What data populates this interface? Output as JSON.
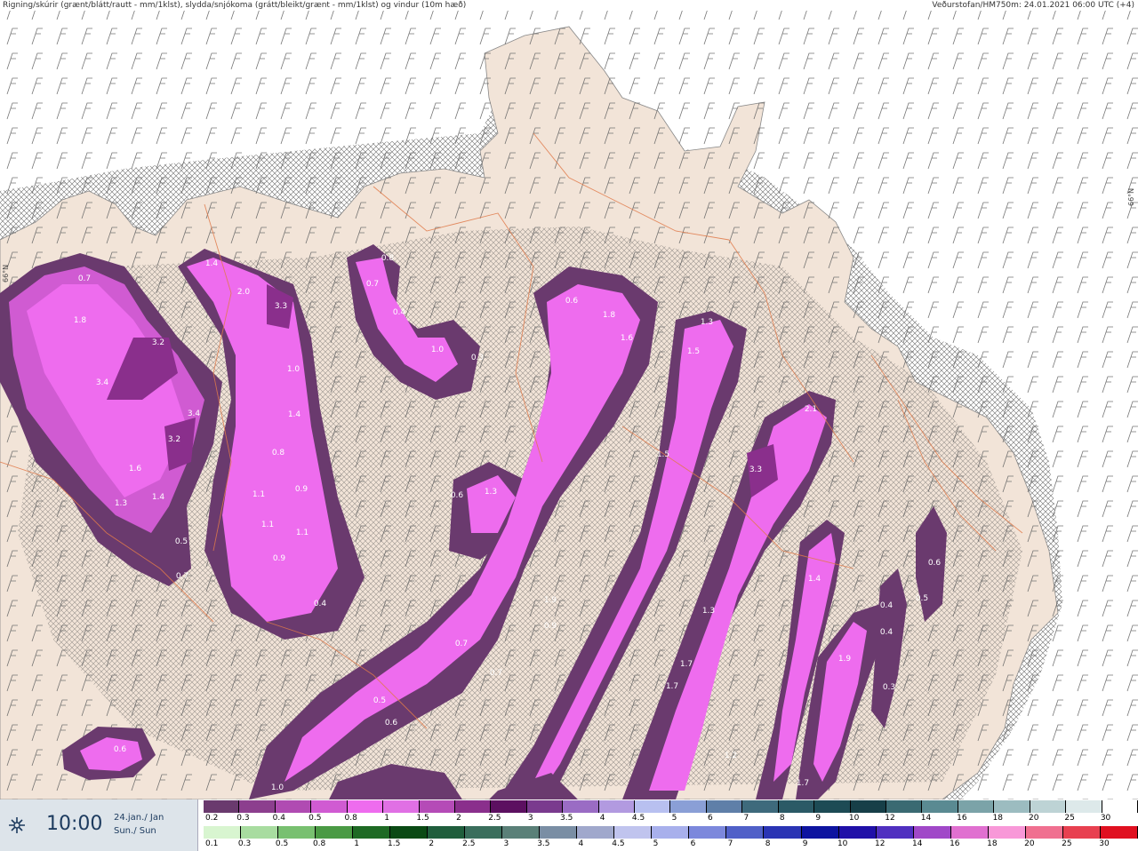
{
  "header": {
    "left": "Rigning/skúrir (grænt/blátt/rautt - mm/1klst), slydda/snjókoma (grátt/bleikt/grænt - mm/1klst) og vindur (10m hæð)",
    "right": "Veðurstofan/HM750m: 24.01.2021 06:00 UTC (+4)"
  },
  "latitude_labels": [
    "66°N",
    "66°N"
  ],
  "footer": {
    "time": "10:00",
    "date_line1": "24.jan./ Jan",
    "date_line2": "Sun./ Sun"
  },
  "legend_snow": {
    "labels": [
      "0.2",
      "0.3",
      "0.4",
      "0.5",
      "0.8",
      "1",
      "1.5",
      "2",
      "2.5",
      "3",
      "3.5",
      "4",
      "4.5",
      "5",
      "6",
      "7",
      "8",
      "9",
      "10",
      "12",
      "14",
      "16",
      "18",
      "20",
      "25",
      "30"
    ],
    "colors": [
      "#6a3a6e",
      "#8c3f8e",
      "#b04bb2",
      "#d05bd2",
      "#ee6cee",
      "#e070e4",
      "#b54bb7",
      "#8a2f8c",
      "#5c1060",
      "#7a3a8e",
      "#9a6cc4",
      "#b29ae0",
      "#b8c0f0",
      "#8a9fd6",
      "#5f7fa8",
      "#3e6a7c",
      "#2b5a66",
      "#1d4b55",
      "#173f48",
      "#3a6a72",
      "#5a8a92",
      "#7ba3a8",
      "#9cbcc0",
      "#bdd3d5",
      "#dde9ea",
      "#ffffff"
    ]
  },
  "legend_rain": {
    "labels": [
      "0.1",
      "0.3",
      "0.5",
      "0.8",
      "1",
      "1.5",
      "2",
      "2.5",
      "3",
      "3.5",
      "4",
      "4.5",
      "5",
      "6",
      "7",
      "8",
      "9",
      "10",
      "12",
      "14",
      "16",
      "18",
      "20",
      "25",
      "30"
    ],
    "colors": [
      "#d8f5d0",
      "#a8dca0",
      "#78c070",
      "#4a9a44",
      "#1e6a24",
      "#0a4a14",
      "#1f5e3c",
      "#3a6e5c",
      "#5a8078",
      "#7a8ea4",
      "#a0a8cc",
      "#c0c4ee",
      "#a8b0ec",
      "#7c88dc",
      "#5060c8",
      "#2a34b4",
      "#0e14a0",
      "#2010a8",
      "#5030c0",
      "#a048c8",
      "#e070d0",
      "#f898d8",
      "#f07090",
      "#e84050",
      "#e01020"
    ]
  },
  "contour_labels": [
    {
      "t": "0.7"
    },
    {
      "t": "1.8"
    },
    {
      "t": "3.2"
    },
    {
      "t": "3.4"
    },
    {
      "t": "3.4"
    },
    {
      "t": "3.2"
    },
    {
      "t": "1.6"
    },
    {
      "t": "1.3"
    },
    {
      "t": "1.4"
    },
    {
      "t": "0.5"
    },
    {
      "t": "0.7"
    },
    {
      "t": "1.4"
    },
    {
      "t": "2.0"
    },
    {
      "t": "3.3"
    },
    {
      "t": "1.0"
    },
    {
      "t": "1.4"
    },
    {
      "t": "0.8"
    },
    {
      "t": "1.1"
    },
    {
      "t": "0.9"
    },
    {
      "t": "1.1"
    },
    {
      "t": "1.1"
    },
    {
      "t": "0.9"
    },
    {
      "t": "0.4"
    },
    {
      "t": "0.8"
    },
    {
      "t": "0.7"
    },
    {
      "t": "0.4"
    },
    {
      "t": "1.0"
    },
    {
      "t": "0.3"
    },
    {
      "t": "0.6"
    },
    {
      "t": "1.3"
    },
    {
      "t": "0.6"
    },
    {
      "t": "1.8"
    },
    {
      "t": "1.6"
    },
    {
      "t": "1.3"
    },
    {
      "t": "1.5"
    },
    {
      "t": "1.5"
    },
    {
      "t": "2.1"
    },
    {
      "t": "3.3"
    },
    {
      "t": "1.9"
    },
    {
      "t": "0.9"
    },
    {
      "t": "0.7"
    },
    {
      "t": "0.7"
    },
    {
      "t": "0.5"
    },
    {
      "t": "0.6"
    },
    {
      "t": "1.4"
    },
    {
      "t": "1.3"
    },
    {
      "t": "1.7"
    },
    {
      "t": "1.7"
    },
    {
      "t": "1.2"
    },
    {
      "t": "1.7"
    },
    {
      "t": "1.9"
    },
    {
      "t": "0.4"
    },
    {
      "t": "0.4"
    },
    {
      "t": "0.6"
    },
    {
      "t": "0.5"
    },
    {
      "t": "0.3"
    },
    {
      "t": "0.6"
    },
    {
      "t": "1.0"
    }
  ]
}
